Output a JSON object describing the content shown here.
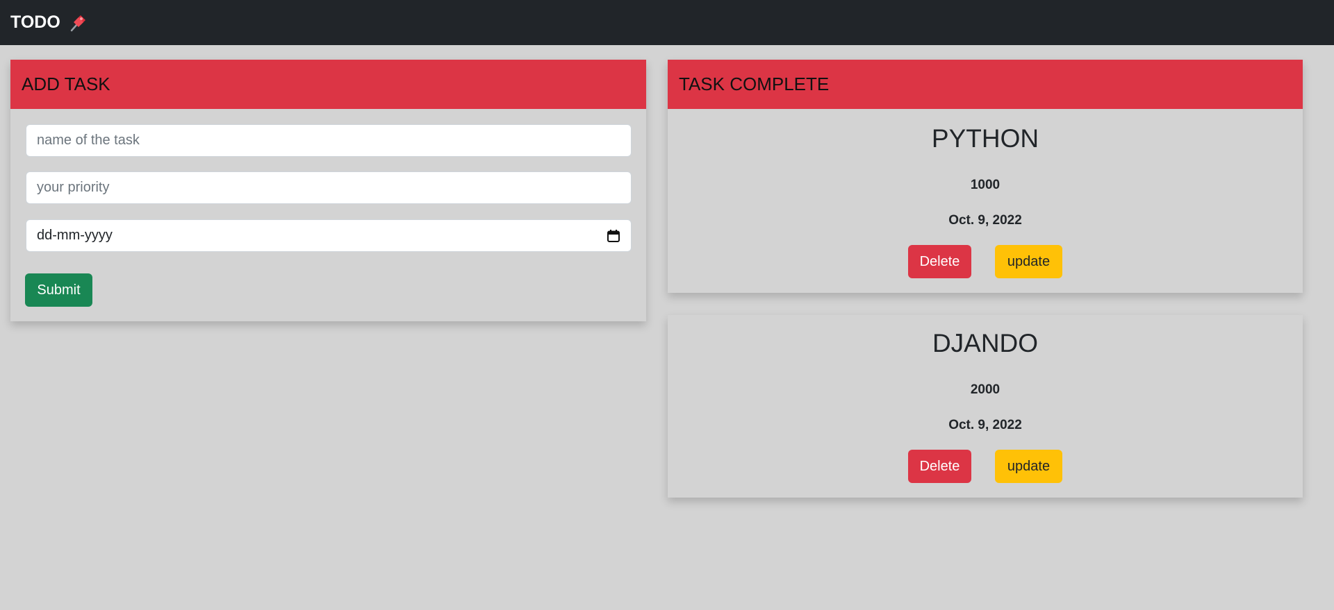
{
  "navbar": {
    "brand": "TODO",
    "brand_icon": "pushpin-icon",
    "background": "#212529"
  },
  "add_task": {
    "header": "ADD TASK",
    "name_placeholder": "name of the task",
    "priority_placeholder": "your priority",
    "date_placeholder": "dd-mm-yyyy",
    "submit_label": "Submit"
  },
  "task_complete": {
    "header": "TASK COMPLETE",
    "tasks": [
      {
        "title": "PYTHON",
        "priority": "1000",
        "date": "Oct. 9, 2022",
        "delete_label": "Delete",
        "update_label": "update"
      },
      {
        "title": "DJANDO",
        "priority": "2000",
        "date": "Oct. 9, 2022",
        "delete_label": "Delete",
        "update_label": "update"
      }
    ]
  },
  "colors": {
    "header_red": "#dc3545",
    "success_green": "#198754",
    "warning_yellow": "#ffc107",
    "page_background": "#d3d3d3"
  }
}
